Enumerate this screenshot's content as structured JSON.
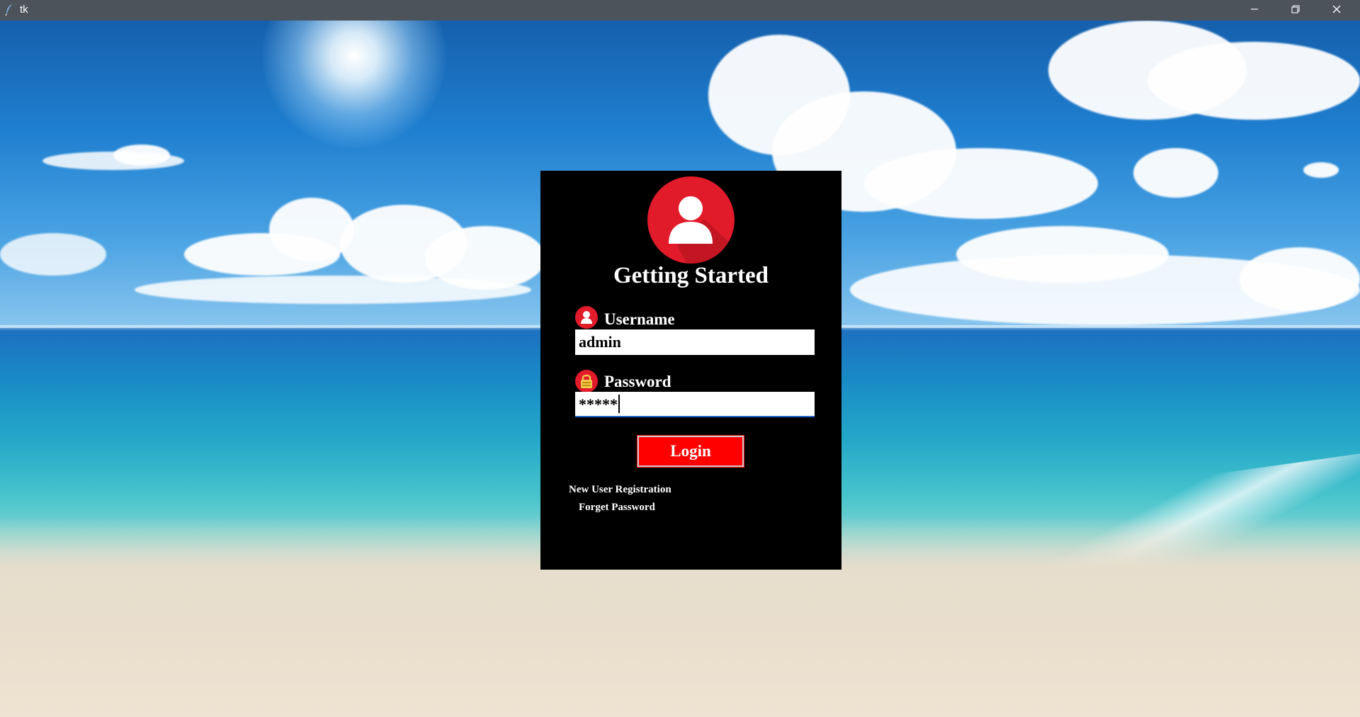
{
  "window": {
    "title": "tk",
    "app_icon": "feather-icon",
    "controls": [
      "minimize-icon",
      "restore-icon",
      "close-icon"
    ]
  },
  "login": {
    "heading": "Getting Started",
    "avatar_icon": "user-icon",
    "username": {
      "label": "Username",
      "icon": "user-icon",
      "value": "admin"
    },
    "password": {
      "label": "Password",
      "icon": "lock-icon",
      "value": "*****"
    },
    "login_button": "Login",
    "register_link": "New User Registration",
    "forgot_link": "Forget Password",
    "colors": {
      "panel": "#000000",
      "accent": "#e21b2b",
      "button": "#ff0000",
      "text": "#ffffff"
    }
  }
}
